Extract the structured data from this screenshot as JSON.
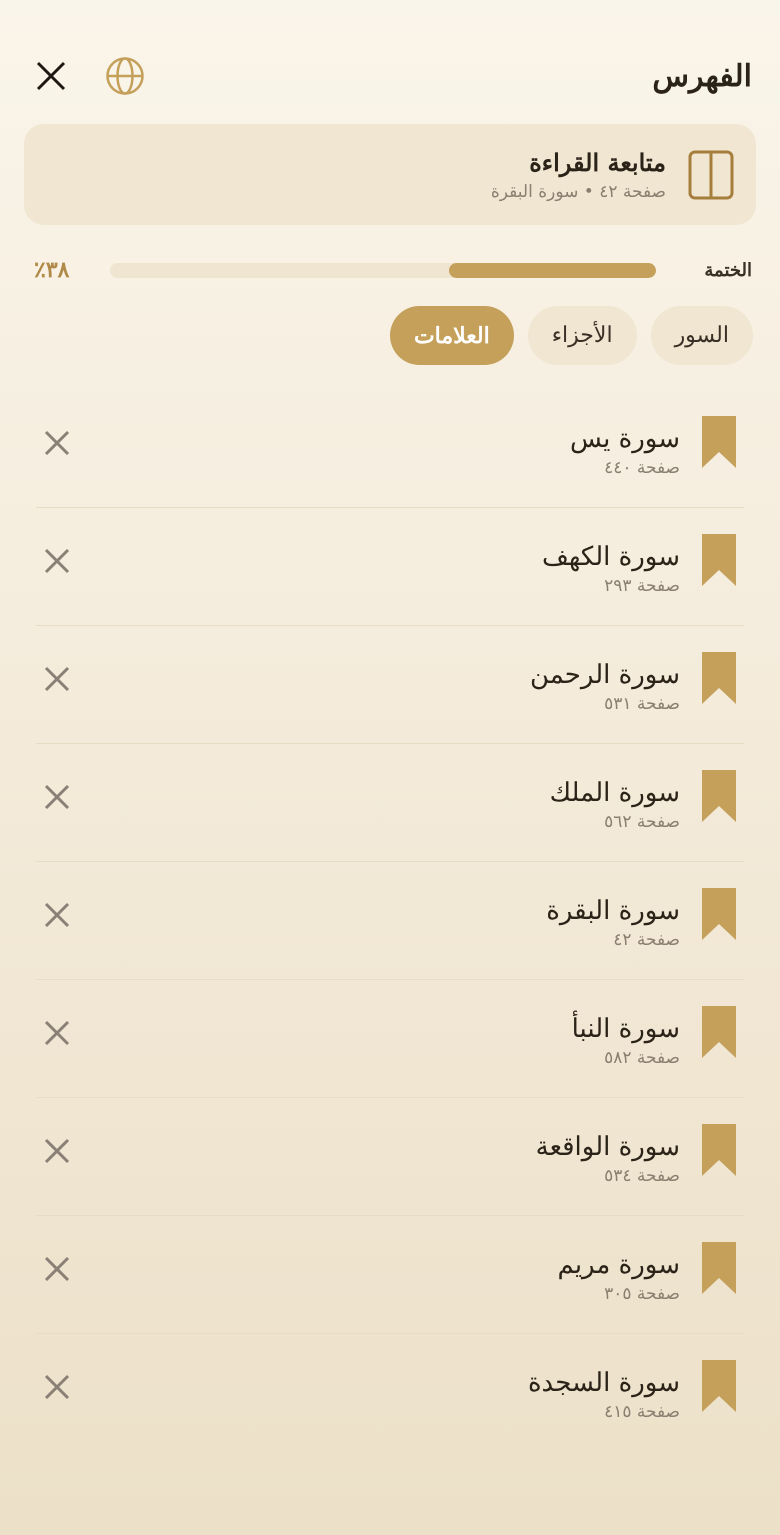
{
  "header": {
    "title": "الفهرس"
  },
  "continue_reading": {
    "title": "متابعة القراءة",
    "subtitle": "صفحة ٤٢ • سورة البقرة"
  },
  "progress": {
    "label": "الختمة",
    "percent_text": "٣٨٪",
    "fraction": 0.38
  },
  "tabs": [
    {
      "label": "السور",
      "active": false
    },
    {
      "label": "الأجزاء",
      "active": false
    },
    {
      "label": "العلامات",
      "active": true
    }
  ],
  "bookmarks": [
    {
      "title": "سورة يس",
      "page": "صفحة ٤٤٠"
    },
    {
      "title": "سورة الكهف",
      "page": "صفحة ٢٩٣"
    },
    {
      "title": "سورة الرحمن",
      "page": "صفحة ٥٣١"
    },
    {
      "title": "سورة الملك",
      "page": "صفحة ٥٦٢"
    },
    {
      "title": "سورة البقرة",
      "page": "صفحة ٤٢"
    },
    {
      "title": "سورة النبأ",
      "page": "صفحة ٥٨٢"
    },
    {
      "title": "سورة الواقعة",
      "page": "صفحة ٥٣٤"
    },
    {
      "title": "سورة مريم",
      "page": "صفحة ٣٠٥"
    },
    {
      "title": "سورة السجدة",
      "page": "صفحة ٤١٥"
    }
  ],
  "colors": {
    "accent": "#c4a05a",
    "background": "#f6efe1",
    "card": "#f0e6d2",
    "text": "#2b2218",
    "muted": "#8a7f70"
  },
  "icons": {
    "close": "close-icon",
    "language": "globe-icon",
    "book": "book-open-icon",
    "bookmark": "bookmark-icon",
    "remove": "remove-icon"
  }
}
